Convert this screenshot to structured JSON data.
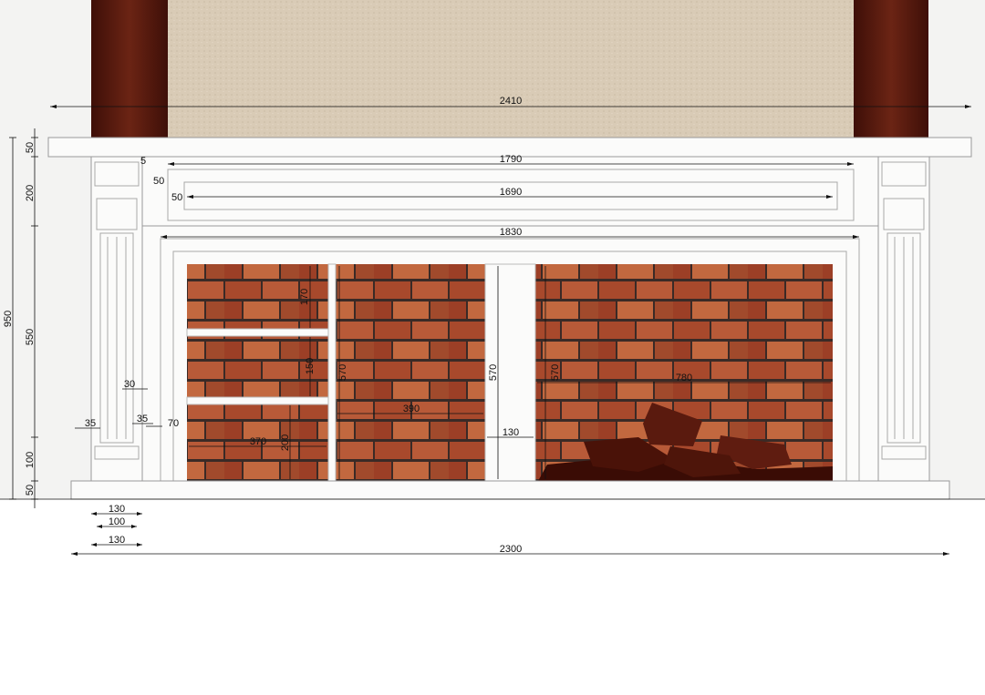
{
  "drawing": {
    "top_overall_width": "2410",
    "frieze_outer_width": "1790",
    "frieze_inner_width": "1690",
    "opening_surround_width": "1830",
    "base_width": "2300",
    "total_height": "950",
    "shelf_thickness": "50",
    "frieze_height": "200",
    "column_height": "550",
    "plinth_height": "100",
    "base_thickness": "50",
    "frieze_border_top": "50",
    "frieze_border_side": "50",
    "frieze_small_offset": "5",
    "left_compartment_top_height": "170",
    "left_compartment_middle_height": "150",
    "left_compartment_bottom_height": "200",
    "left_compartment_width": "370",
    "middle_panel_width": "390",
    "divider_width": "130",
    "right_opening_width": "780",
    "opening_height_a": "570",
    "opening_height_b": "570",
    "opening_height_c": "570",
    "column_setback": "30",
    "column_detail_a": "35",
    "column_detail_b": "35",
    "column_detail_c": "70",
    "column_width_a": "130",
    "column_width_b": "100",
    "column_width_c": "130"
  },
  "colors": {
    "wood": "#5a1a10",
    "wallpaper": "#d9cbb6",
    "marble": "#fbfbfa",
    "brick": "#a8492c",
    "mortar": "#3a2a26",
    "firewood": "#4a1208"
  }
}
